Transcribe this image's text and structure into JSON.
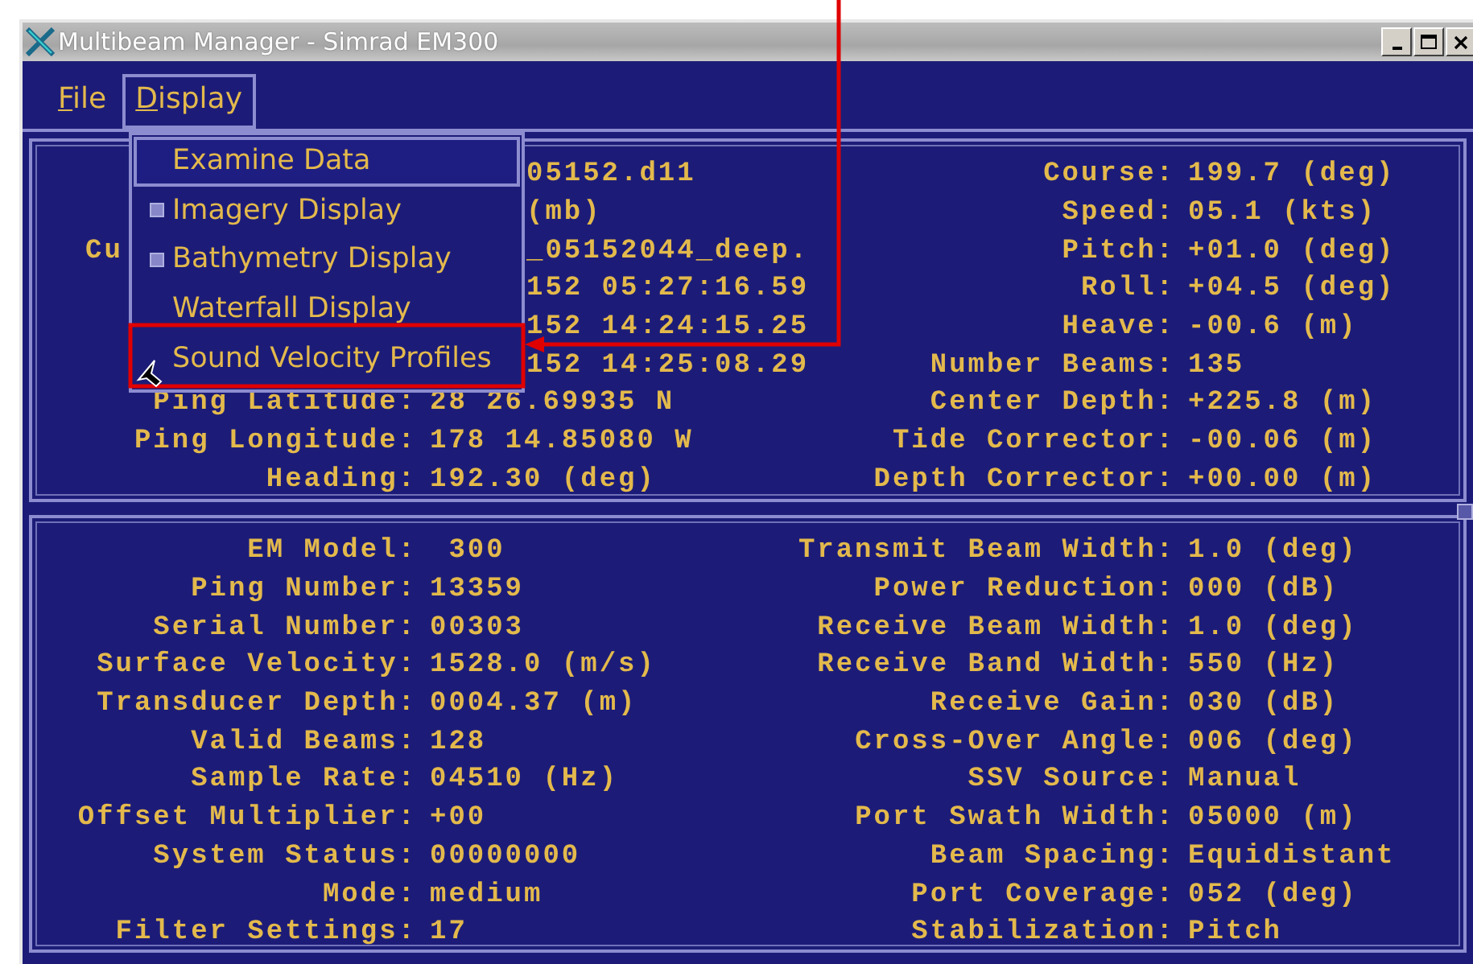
{
  "window": {
    "title": "Multibeam Manager - Simrad EM300"
  },
  "menubar": [
    {
      "label": "File",
      "selected": false
    },
    {
      "label": "Display",
      "selected": true
    }
  ],
  "menu": {
    "items": [
      {
        "label": "Examine Data",
        "kind": "command",
        "selected": true
      },
      {
        "label": "Imagery Display",
        "kind": "toggle",
        "selected": false
      },
      {
        "label": "Bathymetry Display",
        "kind": "toggle",
        "selected": false
      },
      {
        "label": "Waterfall Display",
        "kind": "command",
        "selected": false
      },
      {
        "label": "Sound Velocity Profiles",
        "kind": "command",
        "selected": false
      }
    ]
  },
  "top_panel": {
    "left": [
      {
        "kind": "covered",
        "value": "05152.d11"
      },
      {
        "kind": "covered",
        "value": "(mb)"
      },
      {
        "kind": "covered",
        "label": "Cu",
        "value": "_05152044_deep."
      },
      {
        "kind": "covered",
        "value": "152 05:27:16.59"
      },
      {
        "kind": "covered",
        "value": "152 14:24:15.25"
      },
      {
        "kind": "covered",
        "value": "152 14:25:08.29"
      },
      {
        "kind": "field",
        "label": "Ping Latitude:",
        "value": "28 26.69935 N"
      },
      {
        "kind": "field",
        "label": "Ping Longitude:",
        "value": "178 14.85080 W"
      },
      {
        "kind": "field",
        "label": "Heading:",
        "value": "192.30 (deg)"
      }
    ],
    "right": [
      {
        "kind": "field",
        "label": "Course:",
        "value": "199.7 (deg)"
      },
      {
        "kind": "field",
        "label": "Speed:",
        "value": "05.1 (kts)"
      },
      {
        "kind": "field",
        "label": "Pitch:",
        "value": "+01.0 (deg)"
      },
      {
        "kind": "field",
        "label": "Roll:",
        "value": "+04.5 (deg)"
      },
      {
        "kind": "field",
        "label": "Heave:",
        "value": "-00.6 (m)"
      },
      {
        "kind": "field",
        "label": "Number Beams:",
        "value": "135"
      },
      {
        "kind": "field",
        "label": "Center Depth:",
        "value": "+225.8 (m)"
      },
      {
        "kind": "field",
        "label": "Tide Corrector:",
        "value": "-00.06 (m)"
      },
      {
        "kind": "field",
        "label": "Depth Corrector:",
        "value": "+00.00 (m)"
      }
    ]
  },
  "bottom_panel": {
    "left": [
      {
        "kind": "field",
        "label": "EM Model:",
        "value": " 300"
      },
      {
        "kind": "field",
        "label": "Ping Number:",
        "value": "13359"
      },
      {
        "kind": "field",
        "label": "Serial Number:",
        "value": "00303"
      },
      {
        "kind": "field",
        "label": "Surface Velocity:",
        "value": "1528.0 (m/s)"
      },
      {
        "kind": "field",
        "label": "Transducer Depth:",
        "value": "0004.37 (m)"
      },
      {
        "kind": "field",
        "label": "Valid Beams:",
        "value": "128"
      },
      {
        "kind": "field",
        "label": "Sample Rate:",
        "value": "04510 (Hz)"
      },
      {
        "kind": "field",
        "label": "Offset Multiplier:",
        "value": "+00"
      },
      {
        "kind": "field",
        "label": "System Status:",
        "value": "00000000"
      },
      {
        "kind": "field",
        "label": "Mode:",
        "value": "medium"
      },
      {
        "kind": "field",
        "label": "Filter Settings:",
        "value": "17"
      }
    ],
    "right": [
      {
        "kind": "field",
        "label": "Transmit Beam Width:",
        "value": "1.0 (deg)"
      },
      {
        "kind": "field",
        "label": "Power Reduction:",
        "value": "000 (dB)"
      },
      {
        "kind": "field",
        "label": "Receive Beam Width:",
        "value": "1.0 (deg)"
      },
      {
        "kind": "field",
        "label": "Receive Band Width:",
        "value": "550 (Hz)"
      },
      {
        "kind": "field",
        "label": "Receive Gain:",
        "value": "030 (dB)"
      },
      {
        "kind": "field",
        "label": "Cross-Over Angle:",
        "value": "006 (deg)"
      },
      {
        "kind": "field",
        "label": "SSV Source:",
        "value": "Manual"
      },
      {
        "kind": "field",
        "label": "Port Swath Width:",
        "value": "05000 (m)"
      },
      {
        "kind": "field",
        "label": "Beam Spacing:",
        "value": "Equidistant"
      },
      {
        "kind": "field",
        "label": "Port Coverage:",
        "value": "052 (deg)"
      },
      {
        "kind": "field",
        "label": "Stabilization:",
        "value": "Pitch"
      }
    ]
  }
}
